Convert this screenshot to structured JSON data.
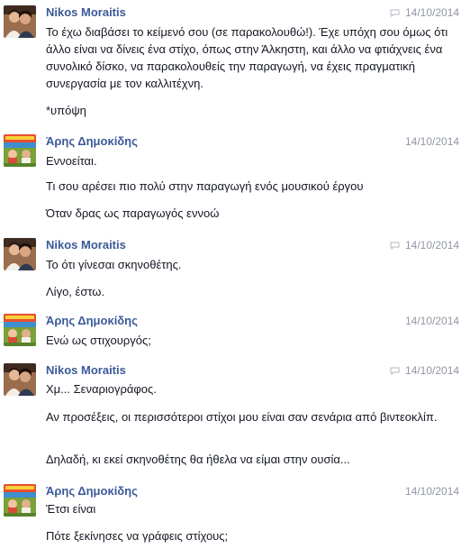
{
  "messages": [
    {
      "author": "Nikos Moraitis",
      "timestamp": "14/10/2014",
      "lines": [
        "Το έχω διαβάσει το κείμενό σου (σε παρακολουθώ!). Έχε υπόχη σου όμως ότι άλλο είναι να δίνεις ένα στίχο, όπως στην Άλκηστη, και άλλο να φτιάχνεις ένα συνολικό δίσκο, να παρακολουθείς την παραγωγή, να έχεις πραγματική συνεργασία με τον καλλιτέχνη.",
        "*υπόψη"
      ]
    },
    {
      "author": "Άρης Δημοκίδης",
      "timestamp": "14/10/2014",
      "lines": [
        "Εννοείται.",
        "Τι σου αρέσει πιο πολύ στην παραγωγή ενός μουσικού έργου",
        "Όταν δρας ως παραγωγός εννοώ"
      ]
    },
    {
      "author": "Nikos Moraitis",
      "timestamp": "14/10/2014",
      "lines": [
        "Το ότι γίνεσαι σκηνοθέτης.",
        "Λίγο, έστω."
      ]
    },
    {
      "author": "Άρης Δημοκίδης",
      "timestamp": "14/10/2014",
      "lines": [
        "Ενώ ως στιχουργός;"
      ]
    },
    {
      "author": "Nikos Moraitis",
      "timestamp": "14/10/2014",
      "lines": [
        "Χμ... Σεναριογράφος.",
        "Αν προσέξεις, οι περισσότεροι στίχοι μου είναι σαν σενάρια από βιντεοκλίπ.",
        "Δηλαδή, κι εκεί σκηνοθέτης θα ήθελα να είμαι στην ουσία..."
      ]
    },
    {
      "author": "Άρης Δημοκίδης",
      "timestamp": "14/10/2014",
      "lines": [
        "Έτσι είναι",
        "Πότε ξεκίνησες να γράφεις στίχους;"
      ]
    }
  ],
  "colors": {
    "author": "#3b5998",
    "timestamp": "#9197a3",
    "text": "#141823",
    "background": "#ffffff"
  },
  "icons": {
    "nikos_avatar": "avatar-photo-two-people",
    "aris_avatar": "avatar-photo-colorful-poster",
    "message_icon": "chat-bubble-icon"
  }
}
